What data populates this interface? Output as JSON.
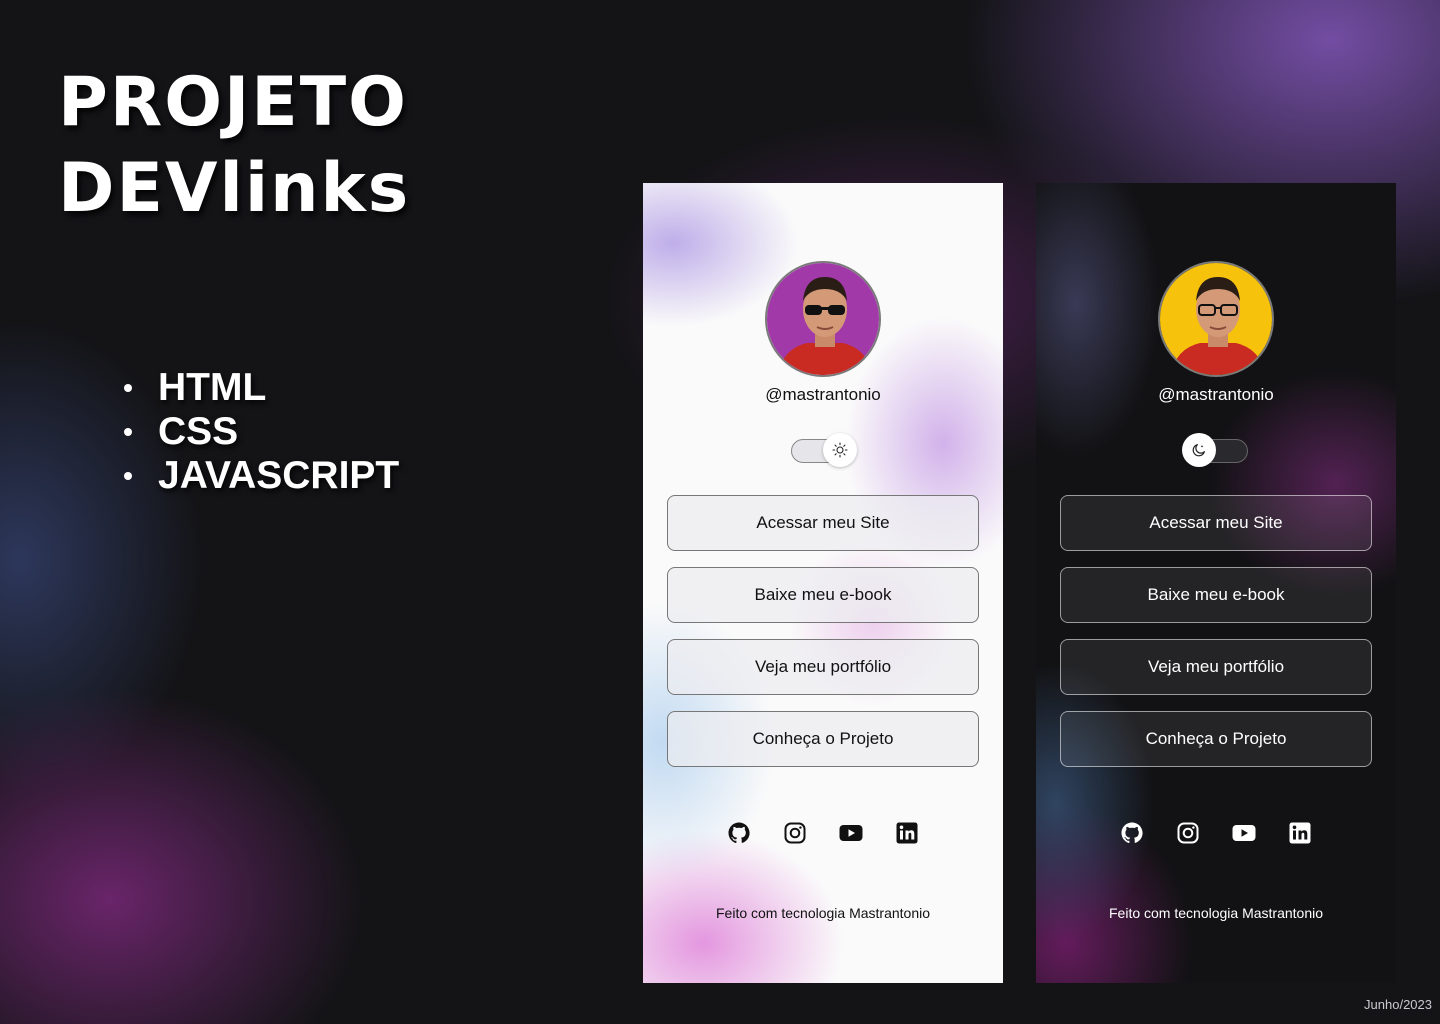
{
  "hero": {
    "title_line1": "PROJETO",
    "title_line2": "DEVlinks"
  },
  "technologies": [
    "HTML",
    "CSS",
    "JAVASCRIPT"
  ],
  "phones": {
    "light": {
      "theme": "light",
      "avatar_bg": "#a13aa8",
      "username": "@mastrantonio",
      "toggle_icon": "sun-icon",
      "buttons": [
        "Acessar meu Site",
        "Baixe meu e-book",
        "Veja meu portfólio",
        "Conheça o Projeto"
      ],
      "socials": [
        "github-icon",
        "instagram-icon",
        "youtube-icon",
        "linkedin-icon"
      ],
      "footer": "Feito com tecnologia Mastrantonio"
    },
    "dark": {
      "theme": "dark",
      "avatar_bg": "#f6c20c",
      "username": "@mastrantonio",
      "toggle_icon": "moon-icon",
      "buttons": [
        "Acessar meu Site",
        "Baixe meu e-book",
        "Veja meu portfólio",
        "Conheça o Projeto"
      ],
      "socials": [
        "github-icon",
        "instagram-icon",
        "youtube-icon",
        "linkedin-icon"
      ],
      "footer": "Feito com tecnologia Mastrantonio"
    }
  },
  "date_stamp": "Junho/2023"
}
